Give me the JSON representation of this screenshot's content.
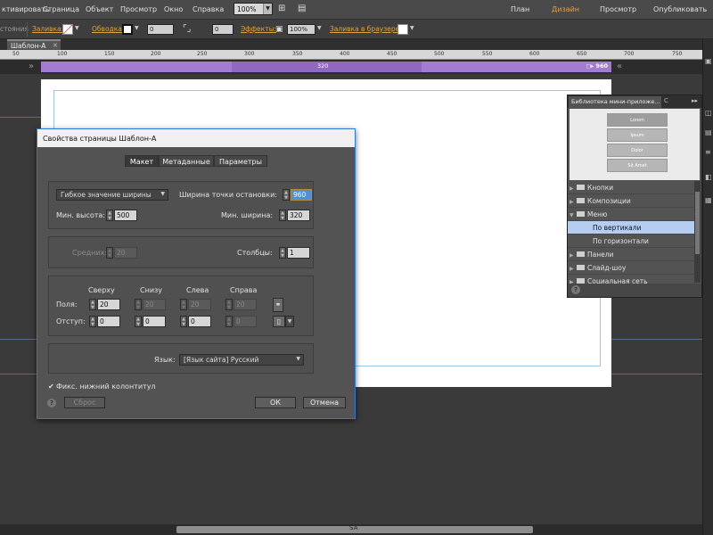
{
  "menu": {
    "items": [
      "ктивировать",
      "Страница",
      "Объект",
      "Просмотр",
      "Окно",
      "Справка"
    ],
    "zoom": "100%",
    "workspaces": [
      {
        "label": "План",
        "active": false
      },
      {
        "label": "Дизайн",
        "active": true
      },
      {
        "label": "Просмотр",
        "active": false
      },
      {
        "label": "Опубликовать",
        "active": false
      }
    ]
  },
  "propbar": {
    "state_label": "стояния",
    "fill_label": "Заливка:",
    "stroke_label": "Обводка:",
    "stroke_value": "0",
    "corner_value": "0",
    "effects_label": "Эффекты:",
    "opacity_value": "100%",
    "browser_fill_label": "Заливка в браузере:"
  },
  "document": {
    "tab_name": "Шаблон-А",
    "ruler_ticks": [
      "50",
      "100",
      "150",
      "200",
      "250",
      "300",
      "350",
      "400",
      "450",
      "500",
      "550",
      "600",
      "650",
      "700",
      "750"
    ],
    "breakpoint_center": "320",
    "breakpoint_right": "960"
  },
  "dialog": {
    "title": "Свойства страницы Шаблон-А",
    "tabs": [
      {
        "label": "Макет",
        "active": true
      },
      {
        "label": "Метаданные",
        "active": false
      },
      {
        "label": "Параметры",
        "active": false
      }
    ],
    "width_mode": "Гибкое значение ширины",
    "breakpoint_width_label": "Ширина точки остановки:",
    "breakpoint_width_value": "960",
    "min_height_label": "Мин. высота:",
    "min_height_value": "500",
    "min_width_label": "Мин. ширина:",
    "min_width_value": "320",
    "gutter_label": "Средних:",
    "gutter_value": "20",
    "columns_label": "Столбцы:",
    "columns_value": "1",
    "col_headers": [
      "Сверху",
      "Снизу",
      "Слева",
      "Справа"
    ],
    "margins_label": "Поля:",
    "margins_values": [
      "20",
      "20",
      "20",
      "20"
    ],
    "padding_label": "Отступ:",
    "padding_values": [
      "0",
      "0",
      "0",
      "0"
    ],
    "language_label": "Язык:",
    "language_value": "[Язык сайта] Русский",
    "sticky_footer_label": "Фикс. нижний колонтитул",
    "sticky_footer_checked": true,
    "reset_label": "Сброс",
    "ok_label": "ОК",
    "cancel_label": "Отмена"
  },
  "library_panel": {
    "tab_title": "Библиотека мини-приложе...",
    "tab2_char": "С",
    "menu_glyph": "▸▸",
    "preview_items": [
      "Lorem",
      "Ipsum",
      "Dolor",
      "Sit Amet"
    ],
    "tree": [
      {
        "label": "Кнопки",
        "level": 0,
        "expanded": false,
        "selected": false
      },
      {
        "label": "Композиции",
        "level": 0,
        "expanded": false,
        "selected": false
      },
      {
        "label": "Меню",
        "level": 0,
        "expanded": true,
        "selected": false
      },
      {
        "label": "По вертикали",
        "level": 1,
        "expanded": false,
        "selected": true
      },
      {
        "label": "По горизонтали",
        "level": 1,
        "expanded": false,
        "selected": false
      },
      {
        "label": "Панели",
        "level": 0,
        "expanded": false,
        "selected": false
      },
      {
        "label": "Слайд-шоу",
        "level": 0,
        "expanded": false,
        "selected": false
      },
      {
        "label": "Социальная сеть",
        "level": 0,
        "expanded": false,
        "selected": false
      }
    ]
  },
  "scrollbar": {
    "grip_text": "SA"
  },
  "colors": {
    "accent": "#e0a23c",
    "breakpoint_bar": "#a37bd0",
    "dialog_focus": "#2a7ad6",
    "selection": "#b7cdf0"
  },
  "icons": [
    "help-icon",
    "link-icon",
    "dropdown-icon",
    "folder-icon",
    "checkbox-icon"
  ]
}
